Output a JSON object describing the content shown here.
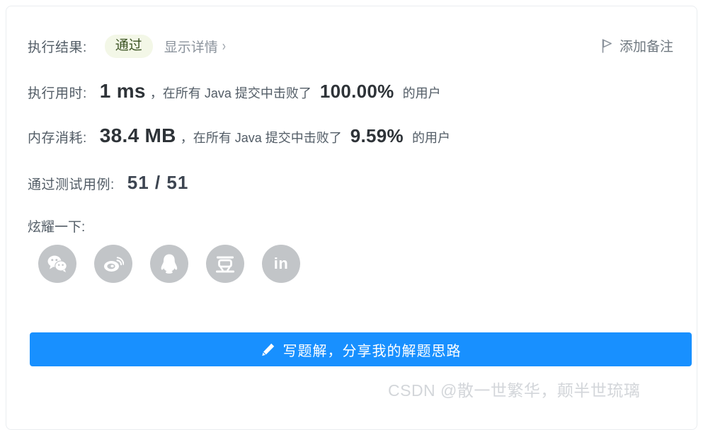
{
  "card": {
    "result_row": {
      "label": "执行结果:",
      "status_badge": "通过",
      "detail_link": "显示详情",
      "detail_chevron": "›"
    },
    "note_button": {
      "icon": "flag-icon",
      "label": "添加备注"
    },
    "runtime_row": {
      "label": "执行用时:",
      "value": "1 ms",
      "middle": "，在所有 Java 提交中击败了",
      "percent": "100.00%",
      "tail": "的用户"
    },
    "memory_row": {
      "label": "内存消耗:",
      "value": "38.4 MB",
      "middle": "，在所有 Java 提交中击败了",
      "percent": "9.59%",
      "tail": "的用户"
    },
    "testcases_row": {
      "label": "通过测试用例:",
      "value": "51 / 51"
    },
    "share": {
      "label": "炫耀一下:",
      "items": [
        {
          "name": "wechat-icon",
          "title": "微信"
        },
        {
          "name": "weibo-icon",
          "title": "微博"
        },
        {
          "name": "qq-icon",
          "title": "QQ"
        },
        {
          "name": "douban-icon",
          "title": "豆瓣",
          "glyph": "豆"
        },
        {
          "name": "linkedin-icon",
          "title": "LinkedIn",
          "glyph": "in"
        }
      ]
    },
    "solution_button": {
      "icon": "pencil-icon",
      "label": "写题解，分享我的解题思路"
    }
  },
  "watermark": "CSDN @散一世繁华，颠半世琉璃",
  "colors": {
    "accent_blue": "#1890ff",
    "badge_bg": "#f3f7e7",
    "badge_text": "#3b5323",
    "icon_gray": "#c2c5c8",
    "text_primary": "#2e3338",
    "text_label": "#525c66",
    "link_gray": "#8b939c",
    "card_border": "#eaedf0",
    "watermark": "#d3d6da"
  }
}
